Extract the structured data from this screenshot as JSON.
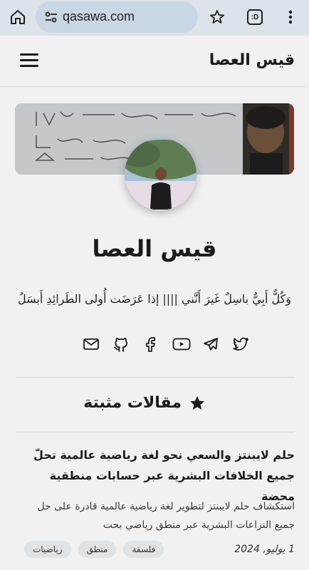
{
  "browser": {
    "url": "qasawa.com",
    "tabs_label": ":D"
  },
  "header": {
    "site_title": "قيس العصا"
  },
  "profile": {
    "name": "قيس العصا",
    "bio": "وَكُلٌّ أَبِيٌّ باسِلٌ غَيرَ أَنَّني |||| إذا عَرَضَت أُولى الطَرائِدِ أَبسَلُ"
  },
  "socials": [
    "twitter-icon",
    "telegram-icon",
    "youtube-icon",
    "facebook-icon",
    "github-icon",
    "email-icon"
  ],
  "featured": {
    "heading": "مقالات مثبتة"
  },
  "article": {
    "title": "حلم لايبنتز والسعي نحو لغة رياضية عالمية تحلّ جميع الخلافات البشرية عبر حسابات منطقية محضة",
    "excerpt": "استكشاف حلم لايبنتز لتطوير لغة رياضية عالمية قادرة على حل جميع النزاعات البشرية عبر منطق رياضي بحت",
    "date": "1 يوليو, 2024",
    "tags": [
      "فلسفة",
      "منطق",
      "رياضيات"
    ]
  },
  "colors": {
    "chrome_bg": "#dde3ea",
    "url_bar": "#c9d6e3",
    "page_bg": "#f1f1f1",
    "tag_bg": "#dfe3e6"
  }
}
